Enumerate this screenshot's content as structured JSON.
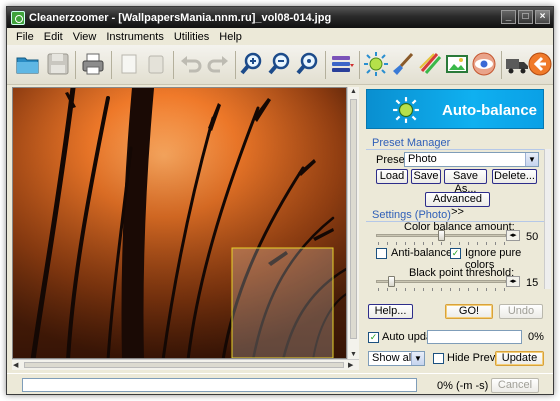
{
  "window": {
    "title": "Cleanerzoomer - [WallpapersMania.nnm.ru]_vol08-014.jpg",
    "buttons": [
      "_",
      "□",
      "×"
    ]
  },
  "menu": [
    "File",
    "Edit",
    "View",
    "Instruments",
    "Utilities",
    "Help"
  ],
  "toolbar": {
    "icons": [
      "open-folder-icon",
      "save-icon",
      "print-icon",
      "copy-icon",
      "paste-icon",
      "undo-icon",
      "redo-icon",
      "zoom-in-icon",
      "zoom-out-icon",
      "zoom-fit-icon",
      "stack-icon",
      "auto-balance-icon",
      "brush-icon",
      "pens-icon",
      "picture-icon",
      "eye-icon",
      "truck-icon",
      "back-arrow-icon"
    ]
  },
  "banner": {
    "title": "Auto-balance"
  },
  "preset_manager": {
    "section_title": "Preset Manager",
    "preset_label": "Preset:",
    "preset_value": "Photo",
    "load": "Load",
    "save": "Save",
    "save_as": "Save As...",
    "delete": "Delete...",
    "advanced": "Advanced >>"
  },
  "settings": {
    "section_title": "Settings (Photo)",
    "color_balance_label": "Color balance amount:",
    "color_balance_value": "50",
    "color_balance_fraction": 0.5,
    "anti_balance": "Anti-balance",
    "anti_balance_checked": false,
    "ignore_pure_colors": "Ignore pure colors",
    "ignore_pure_colors_checked": true,
    "black_point_label": "Black point threshold:",
    "black_point_value": "15",
    "black_point_fraction": 0.1
  },
  "actions": {
    "help": "Help...",
    "go": "GO!",
    "undo": "Undo"
  },
  "auto_update": {
    "label": "Auto update",
    "checked": true,
    "percent": "0%"
  },
  "view": {
    "show_value": "Show all",
    "hide_preview": "Hide Preview",
    "hide_preview_checked": false,
    "update": "Update"
  },
  "status": {
    "progress_text": "0% (-m -s)",
    "cancel": "Cancel"
  }
}
